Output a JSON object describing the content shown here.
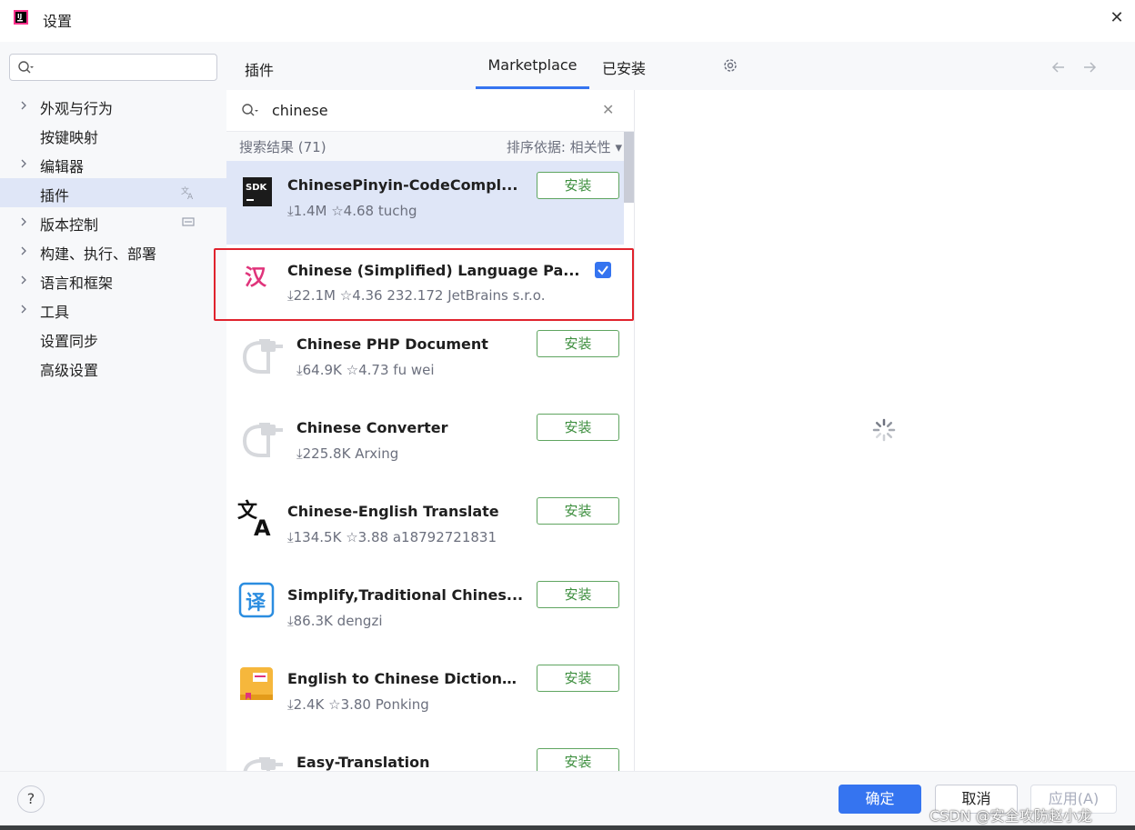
{
  "window": {
    "title": "设置"
  },
  "sidebar": {
    "items": [
      {
        "label": "外观与行为",
        "expandable": true
      },
      {
        "label": "按键映射",
        "expandable": false
      },
      {
        "label": "编辑器",
        "expandable": true
      },
      {
        "label": "插件",
        "expandable": false,
        "selected": true
      },
      {
        "label": "版本控制",
        "expandable": true
      },
      {
        "label": "构建、执行、部署",
        "expandable": true
      },
      {
        "label": "语言和框架",
        "expandable": true
      },
      {
        "label": "工具",
        "expandable": true
      },
      {
        "label": "设置同步",
        "expandable": false
      },
      {
        "label": "高级设置",
        "expandable": false
      }
    ]
  },
  "header": {
    "title": "插件",
    "tabs": [
      {
        "label": "Marketplace",
        "active": true
      },
      {
        "label": "已安装",
        "active": false
      }
    ]
  },
  "search": {
    "value": "chinese"
  },
  "results": {
    "count_label": "搜索结果 (71)",
    "sort_label": "排序依据: 相关性"
  },
  "plugins": [
    {
      "name": "ChinesePinyin-CodeCompl...",
      "downloads": "1.4M",
      "rating": "4.68",
      "vendor": "tuchg",
      "action": "安装",
      "icon": "sdk-icon",
      "selected": true
    },
    {
      "name": "Chinese (Simplified) Language Pa...",
      "downloads": "22.1M",
      "rating": "4.36",
      "extra": "232.172",
      "vendor": "JetBrains s.r.o.",
      "installed": true,
      "icon": "han-char-icon"
    },
    {
      "name": "Chinese PHP Document",
      "downloads": "64.9K",
      "rating": "4.73",
      "vendor": "fu wei",
      "action": "安装",
      "icon": "plug-icon"
    },
    {
      "name": "Chinese Converter",
      "downloads": "225.8K",
      "vendor": "Arxing",
      "action": "安装",
      "icon": "plug-icon"
    },
    {
      "name": "Chinese-English Translate",
      "downloads": "134.5K",
      "rating": "3.88",
      "vendor": "a18792721831",
      "action": "安装",
      "icon": "translate-icon"
    },
    {
      "name": "Simplify,Traditional Chines...",
      "downloads": "86.3K",
      "vendor": "dengzi",
      "action": "安装",
      "icon": "yi-char-icon"
    },
    {
      "name": "English to Chinese Dictiona...",
      "downloads": "2.4K",
      "rating": "3.80",
      "vendor": "Ponking",
      "action": "安装",
      "icon": "book-icon"
    },
    {
      "name": "Easy-Translation",
      "action": "安装",
      "icon": "plug-icon"
    }
  ],
  "footer": {
    "help": "?",
    "ok": "确定",
    "cancel": "取消",
    "apply": "应用(A)"
  },
  "watermark": "CSDN @安全攻防赵小龙",
  "colors": {
    "accent": "#3574f0",
    "install_green": "#3e8f3f",
    "highlight_red": "#e0232d",
    "selected_bg": "#dfe6f7"
  }
}
